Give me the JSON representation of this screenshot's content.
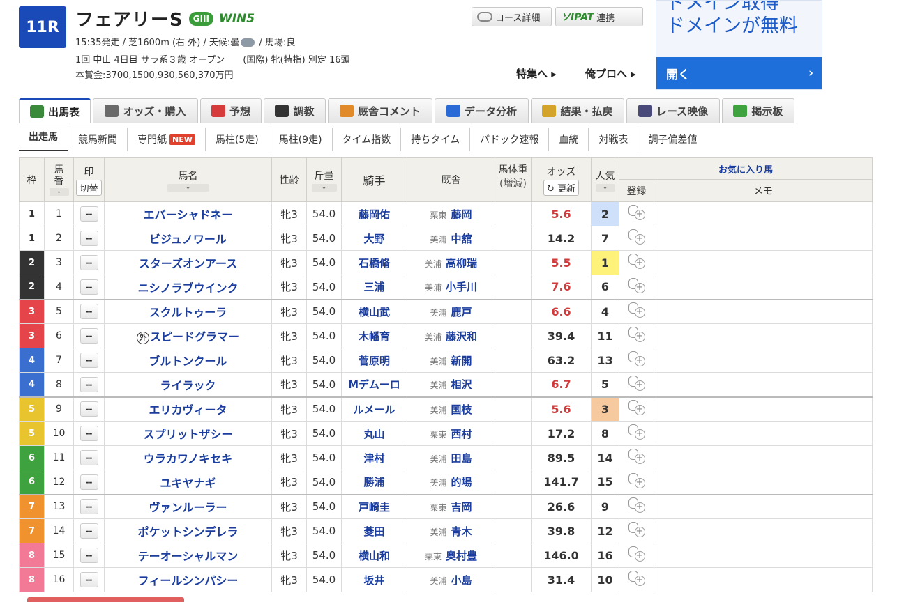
{
  "race": {
    "number": "11R",
    "name": "フェアリーS",
    "grade": "GIII",
    "win5": "WIN5",
    "info_line1_pre": "15:35発走 / 芝1600m (右 外) / 天候:曇",
    "info_line1_post": " / 馬場:良",
    "info_line2": "1回 中山 4日目 サラ系３歳 オープン　　(国際) 牝(特指) 別定 16頭",
    "info_line3": "本賞金:3700,1500,930,560,370万円"
  },
  "header_buttons": {
    "course": "コース詳細",
    "ipat_logo": "ソIPAT",
    "ipat_label": "連携",
    "special": "特集へ ▸",
    "orepro": "俺プロへ ▸"
  },
  "ad": {
    "top_text": "ドメインが無料",
    "prev_text": "ドメイン取得",
    "open": "開く",
    "open_arrow": "›"
  },
  "tabs": [
    {
      "label": "出馬表",
      "color": "#3b8a3b"
    },
    {
      "label": "オッズ・購入",
      "color": "#6a6a6a"
    },
    {
      "label": "予想",
      "color": "#d63a3a"
    },
    {
      "label": "調教",
      "color": "#333333"
    },
    {
      "label": "厩舎コメント",
      "color": "#e08a2a"
    },
    {
      "label": "データ分析",
      "color": "#2a6ad6"
    },
    {
      "label": "結果・払戻",
      "color": "#d4a32a"
    },
    {
      "label": "レース映像",
      "color": "#4a4a7a"
    },
    {
      "label": "掲示板",
      "color": "#3ea33e"
    }
  ],
  "subnav": [
    "出走馬",
    "競馬新聞",
    "専門紙",
    "馬柱(5走)",
    "馬柱(9走)",
    "タイム指数",
    "持ちタイム",
    "パドック速報",
    "血統",
    "対戦表",
    "調子偏差値"
  ],
  "subnav_new": "NEW",
  "columns": {
    "waku": "枠",
    "umaban": "馬\n番",
    "mark": "印",
    "mark_toggle": "切替",
    "horse": "馬名",
    "sexage": "性齢",
    "weight": "斤量",
    "jockey": "騎手",
    "trainer": "厩舎",
    "body_weight": "馬体重",
    "body_weight_sub": "(増減)",
    "odds": "オッズ",
    "refresh": "更新",
    "popularity": "人気",
    "favorites": "お気に入り馬",
    "register": "登録",
    "memo": "メモ",
    "sort_arrow": "⌄"
  },
  "waku_colors": {
    "1": {
      "bg": "#ffffff",
      "fg": "#333333"
    },
    "2": {
      "bg": "#333333",
      "fg": "#ffffff"
    },
    "3": {
      "bg": "#e5454a",
      "fg": "#ffffff"
    },
    "4": {
      "bg": "#3a6fcf",
      "fg": "#ffffff"
    },
    "5": {
      "bg": "#e8c42e",
      "fg": "#ffffff"
    },
    "6": {
      "bg": "#3ea33e",
      "fg": "#ffffff"
    },
    "7": {
      "bg": "#f0922e",
      "fg": "#ffffff"
    },
    "8": {
      "bg": "#f27a96",
      "fg": "#ffffff"
    }
  },
  "pop_highlight": {
    "1": "#fff27a",
    "2": "#cfe0fb",
    "3": "#f7c99e"
  },
  "mark_default": "--",
  "gai_mark": "外",
  "entries": [
    {
      "waku": "1",
      "umaban": "1",
      "horse": "エバーシャドネー",
      "gai": false,
      "sexage": "牝3",
      "weight": "54.0",
      "jockey": "藤岡佑",
      "area": "栗東",
      "trainer": "藤岡",
      "odds": "5.6",
      "hot": true,
      "pop": "2"
    },
    {
      "waku": "1",
      "umaban": "2",
      "horse": "ビジュノワール",
      "gai": false,
      "sexage": "牝3",
      "weight": "54.0",
      "jockey": "大野",
      "area": "美浦",
      "trainer": "中舘",
      "odds": "14.2",
      "hot": false,
      "pop": "7"
    },
    {
      "waku": "2",
      "umaban": "3",
      "horse": "スターズオンアース",
      "gai": false,
      "sexage": "牝3",
      "weight": "54.0",
      "jockey": "石橋脩",
      "area": "美浦",
      "trainer": "高柳瑞",
      "odds": "5.5",
      "hot": true,
      "pop": "1"
    },
    {
      "waku": "2",
      "umaban": "4",
      "horse": "ニシノラブウインク",
      "gai": false,
      "sexage": "牝3",
      "weight": "54.0",
      "jockey": "三浦",
      "area": "美浦",
      "trainer": "小手川",
      "odds": "7.6",
      "hot": true,
      "pop": "6"
    },
    {
      "waku": "3",
      "umaban": "5",
      "horse": "スクルトゥーラ",
      "gai": false,
      "sexage": "牝3",
      "weight": "54.0",
      "jockey": "横山武",
      "area": "美浦",
      "trainer": "鹿戸",
      "odds": "6.6",
      "hot": true,
      "pop": "4"
    },
    {
      "waku": "3",
      "umaban": "6",
      "horse": "スピードグラマー",
      "gai": true,
      "sexage": "牝3",
      "weight": "54.0",
      "jockey": "木幡育",
      "area": "美浦",
      "trainer": "藤沢和",
      "odds": "39.4",
      "hot": false,
      "pop": "11"
    },
    {
      "waku": "4",
      "umaban": "7",
      "horse": "ブルトンクール",
      "gai": false,
      "sexage": "牝3",
      "weight": "54.0",
      "jockey": "菅原明",
      "area": "美浦",
      "trainer": "新開",
      "odds": "63.2",
      "hot": false,
      "pop": "13"
    },
    {
      "waku": "4",
      "umaban": "8",
      "horse": "ライラック",
      "gai": false,
      "sexage": "牝3",
      "weight": "54.0",
      "jockey": "Mデムーロ",
      "area": "美浦",
      "trainer": "相沢",
      "odds": "6.7",
      "hot": true,
      "pop": "5"
    },
    {
      "waku": "5",
      "umaban": "9",
      "horse": "エリカヴィータ",
      "gai": false,
      "sexage": "牝3",
      "weight": "54.0",
      "jockey": "ルメール",
      "area": "美浦",
      "trainer": "国枝",
      "odds": "5.6",
      "hot": true,
      "pop": "3"
    },
    {
      "waku": "5",
      "umaban": "10",
      "horse": "スプリットザシー",
      "gai": false,
      "sexage": "牝3",
      "weight": "54.0",
      "jockey": "丸山",
      "area": "栗東",
      "trainer": "西村",
      "odds": "17.2",
      "hot": false,
      "pop": "8"
    },
    {
      "waku": "6",
      "umaban": "11",
      "horse": "ウラカワノキセキ",
      "gai": false,
      "sexage": "牝3",
      "weight": "54.0",
      "jockey": "津村",
      "area": "美浦",
      "trainer": "田島",
      "odds": "89.5",
      "hot": false,
      "pop": "14"
    },
    {
      "waku": "6",
      "umaban": "12",
      "horse": "ユキヤナギ",
      "gai": false,
      "sexage": "牝3",
      "weight": "54.0",
      "jockey": "勝浦",
      "area": "美浦",
      "trainer": "的場",
      "odds": "141.7",
      "hot": false,
      "pop": "15"
    },
    {
      "waku": "7",
      "umaban": "13",
      "horse": "ヴァンルーラー",
      "gai": false,
      "sexage": "牝3",
      "weight": "54.0",
      "jockey": "戸崎圭",
      "area": "栗東",
      "trainer": "吉岡",
      "odds": "26.6",
      "hot": false,
      "pop": "9"
    },
    {
      "waku": "7",
      "umaban": "14",
      "horse": "ポケットシンデレラ",
      "gai": false,
      "sexage": "牝3",
      "weight": "54.0",
      "jockey": "菱田",
      "area": "美浦",
      "trainer": "青木",
      "odds": "39.8",
      "hot": false,
      "pop": "12"
    },
    {
      "waku": "8",
      "umaban": "15",
      "horse": "テーオーシャルマン",
      "gai": false,
      "sexage": "牝3",
      "weight": "54.0",
      "jockey": "横山和",
      "area": "栗東",
      "trainer": "奥村豊",
      "odds": "146.0",
      "hot": false,
      "pop": "16"
    },
    {
      "waku": "8",
      "umaban": "16",
      "horse": "フィールシンパシー",
      "gai": false,
      "sexage": "牝3",
      "weight": "54.0",
      "jockey": "坂井",
      "area": "美浦",
      "trainer": "小島",
      "odds": "31.4",
      "hot": false,
      "pop": "10"
    }
  ]
}
